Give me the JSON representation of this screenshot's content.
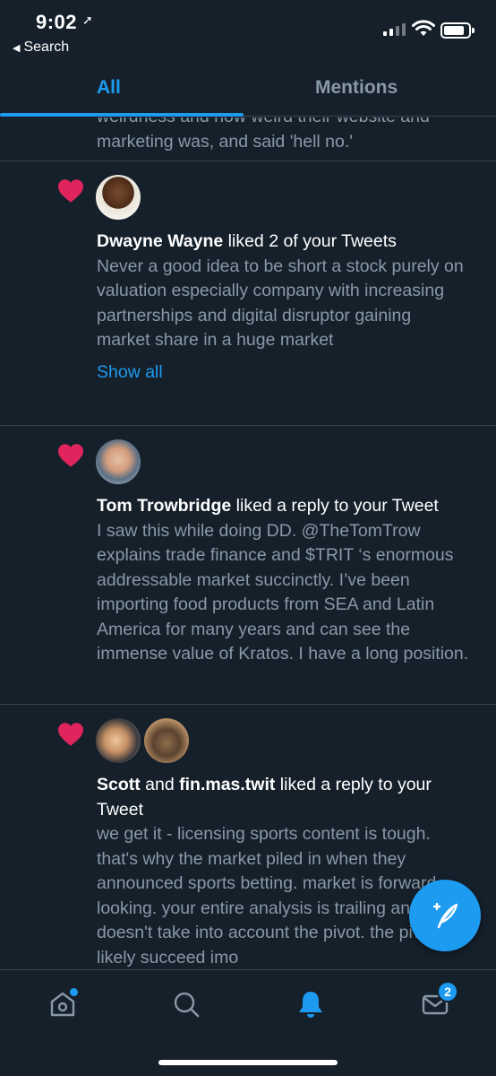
{
  "status_bar": {
    "time": "9:02",
    "back_label": "Search"
  },
  "tabs": [
    {
      "label": "All",
      "active": true
    },
    {
      "label": "Mentions",
      "active": false
    }
  ],
  "notifications": [
    {
      "partial_text": "weirdness and how weird their website and marketing was, and said 'hell no.'"
    },
    {
      "actor": "Dwayne Wayne",
      "action": " liked 2 of your Tweets",
      "text": "Never a good idea to be short a stock purely on valuation especially company with increasing partnerships and digital disruptor gaining market share in a huge market",
      "show_all": "Show all"
    },
    {
      "actor": "Tom Trowbridge",
      "action": " liked a reply to your Tweet",
      "text": "I saw this while doing DD. @TheTomTrow explains trade finance and $TRIT ‘s enormous addressable market succinctly. I’ve been importing food products from SEA and Latin America for many years and can see the immense value of Kratos.  I have a long position."
    },
    {
      "actor": "Scott",
      "connector": " and ",
      "actor2": "fin.mas.twit",
      "action": " liked a reply to your Tweet",
      "text": "we get it - licensing sports content is tough. that's why the market piled in when they announced sports betting. market is forward looking. your entire analysis is trailing and doesn't take into account the pivot. the pivot will likely succeed imo"
    }
  ],
  "bottom_nav": {
    "messages_badge": "2"
  },
  "colors": {
    "background": "#15202b",
    "accent": "#1d9bf0",
    "heart": "#e0245e",
    "secondary_text": "#8899a6",
    "divider": "#38444d"
  },
  "icons": [
    "location-arrow-icon",
    "back-triangle-icon",
    "signal-icon",
    "wifi-icon",
    "battery-icon",
    "heart-icon",
    "compose-icon",
    "home-icon",
    "search-icon",
    "bell-icon",
    "mail-icon"
  ]
}
